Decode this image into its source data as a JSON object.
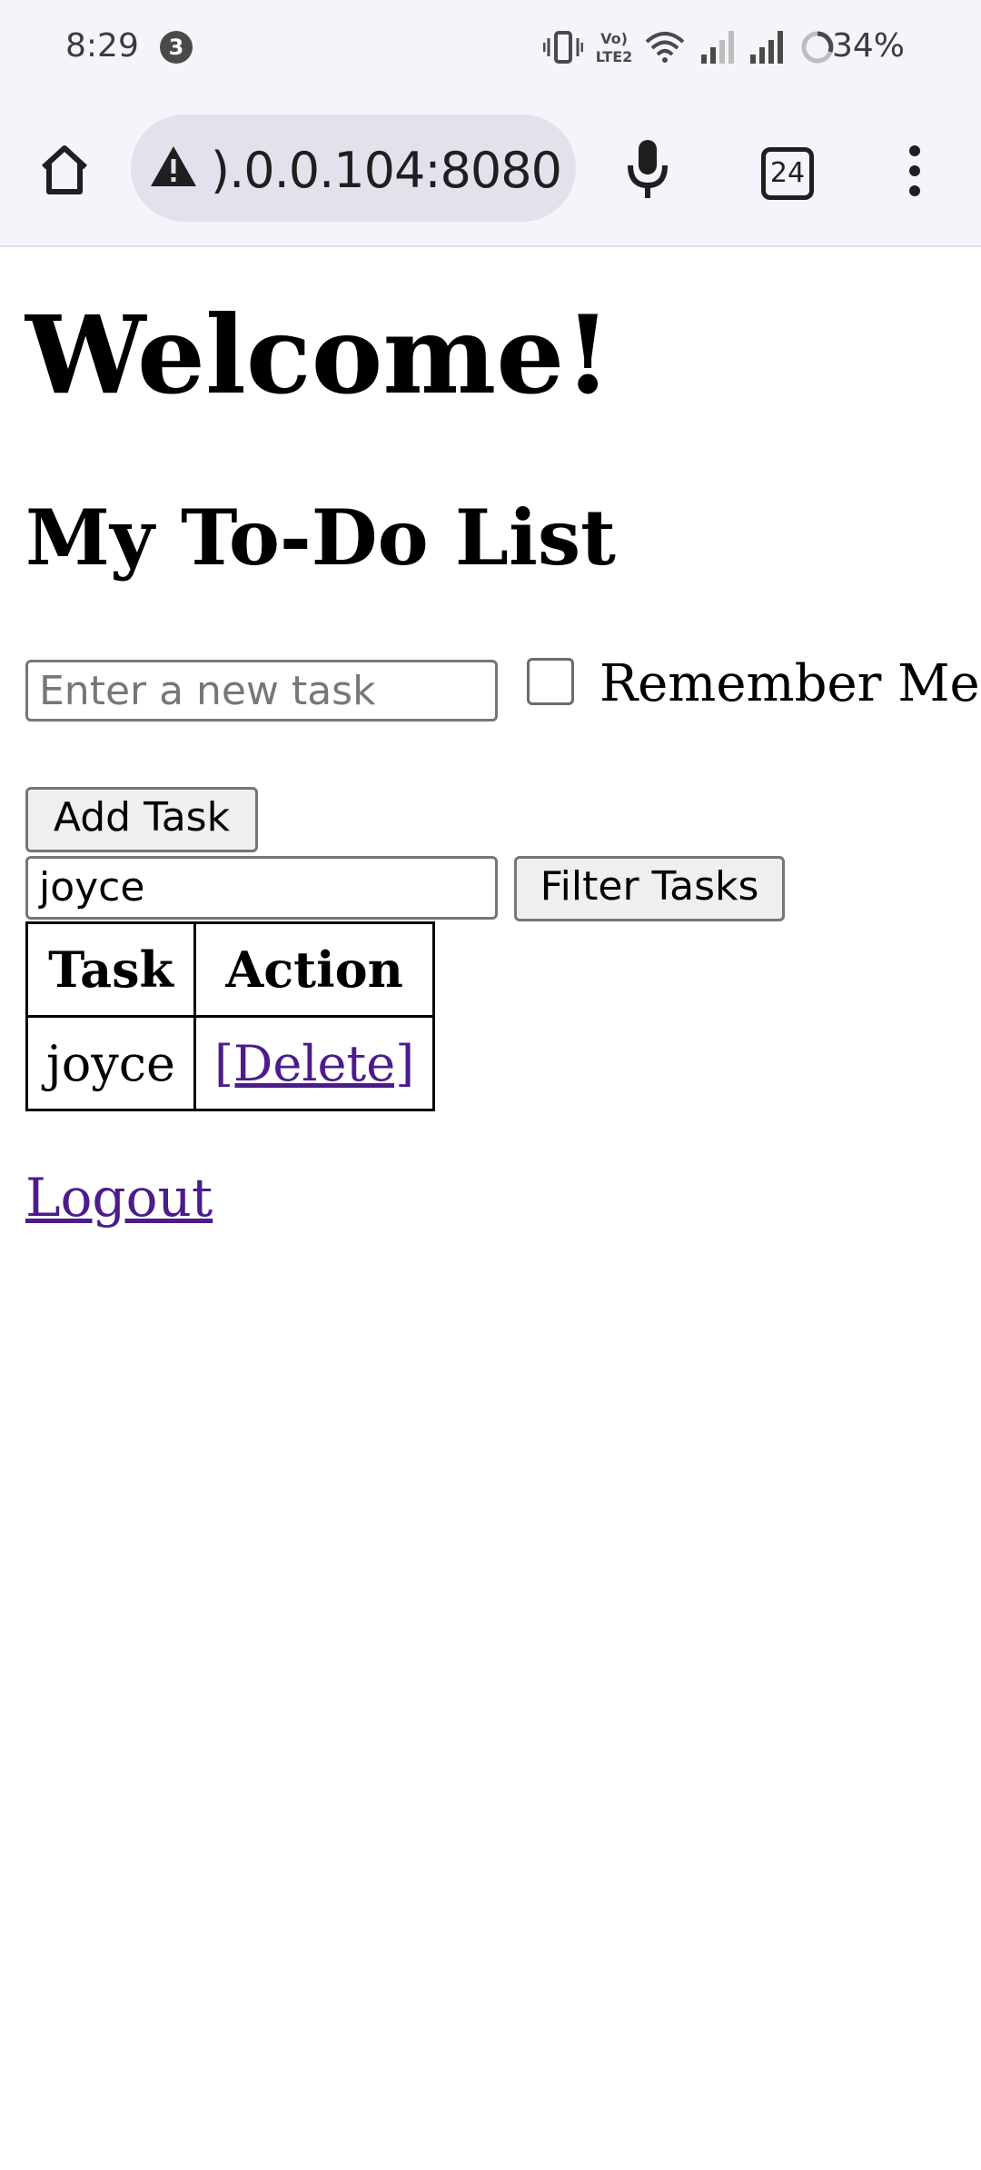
{
  "status_bar": {
    "time": "8:29",
    "notification_count": "3",
    "battery": "34%",
    "icons": [
      "vibrate-icon",
      "volte-icon",
      "wifi-icon",
      "signal-icon",
      "signal-icon",
      "battery-saver-icon"
    ],
    "volte_text": "Vo) LTE2"
  },
  "browser": {
    "url": ").0.0.104:8080",
    "tab_count": "24",
    "icons": [
      "home-icon",
      "warning-icon",
      "mic-icon",
      "tabs-icon",
      "more-vert-icon"
    ]
  },
  "page": {
    "welcome": "Welcome!",
    "title": "My To-Do List",
    "task_input_placeholder": "Enter a new task",
    "remember_label": "Remember Me",
    "add_button": "Add Task",
    "filter_value": "joyce",
    "filter_button": "Filter Tasks",
    "table": {
      "headers": [
        "Task",
        "Action"
      ],
      "rows": [
        {
          "task": "joyce",
          "action": "[Delete]"
        }
      ]
    },
    "logout": "Logout"
  },
  "colors": {
    "link": "#4b1c8a",
    "chrome_bg": "#f5f4fa",
    "urlbar_bg": "#e3e2ec"
  }
}
